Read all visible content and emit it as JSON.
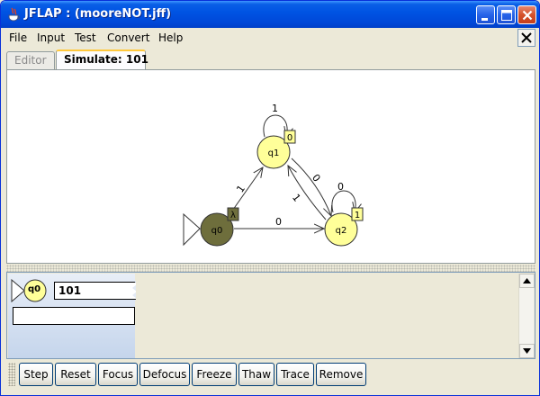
{
  "window": {
    "title": "JFLAP : (mooreNOT.jff)"
  },
  "menu": {
    "items": [
      "File",
      "Input",
      "Test",
      "Convert",
      "Help"
    ]
  },
  "tabs": [
    {
      "label": "Editor",
      "active": false
    },
    {
      "label": "Simulate: 101",
      "active": true
    }
  ],
  "automaton": {
    "states": [
      {
        "id": "q0",
        "output": "λ",
        "initial": true,
        "current": true
      },
      {
        "id": "q1",
        "output": "0",
        "initial": false,
        "current": false
      },
      {
        "id": "q2",
        "output": "1",
        "initial": false,
        "current": false
      }
    ],
    "transitions": [
      {
        "from": "q1",
        "to": "q1",
        "label": "1"
      },
      {
        "from": "q2",
        "to": "q2",
        "label": "0"
      },
      {
        "from": "q0",
        "to": "q1",
        "label": "1"
      },
      {
        "from": "q0",
        "to": "q2",
        "label": "0"
      },
      {
        "from": "q1",
        "to": "q2",
        "label": "0"
      },
      {
        "from": "q2",
        "to": "q1",
        "label": "1"
      }
    ]
  },
  "configuration": {
    "state": "q0",
    "input": "101",
    "output": ""
  },
  "toolbar": {
    "buttons": [
      "Step",
      "Reset",
      "Focus",
      "Defocus",
      "Freeze",
      "Thaw",
      "Trace",
      "Remove"
    ]
  },
  "colors": {
    "state_fill": "#ffff99",
    "current_state_fill": "#6e6e3c",
    "config_gradient_top": "#e8eef7",
    "config_gradient_bottom": "#c5d5ec",
    "titlebar": "#0054e3"
  }
}
